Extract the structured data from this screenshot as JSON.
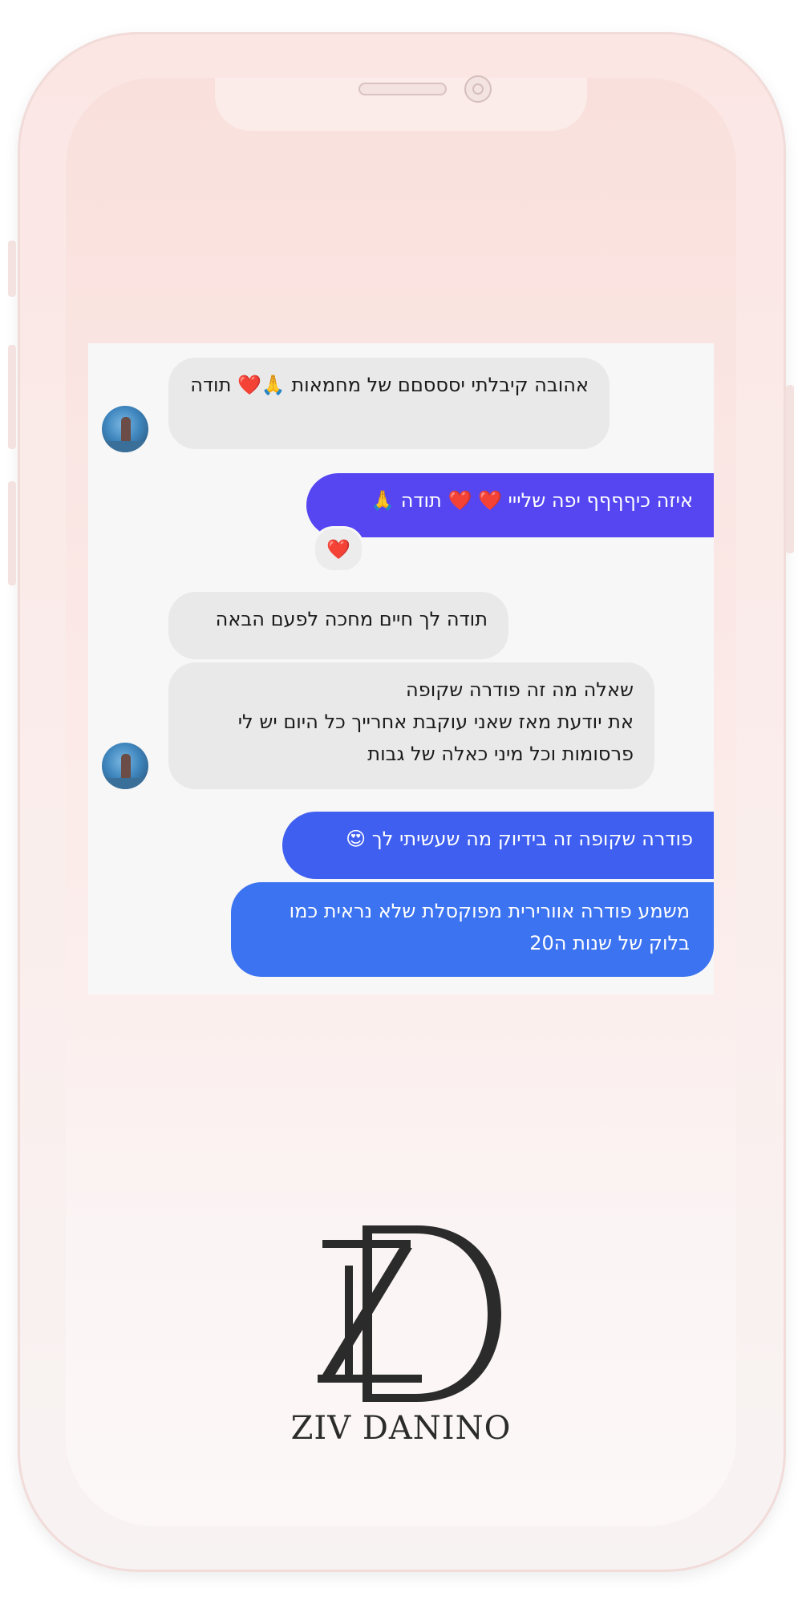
{
  "brand": {
    "name": "ZIV DANINO"
  },
  "chat": {
    "messages": [
      {
        "text": "אהובה קיבלתי יסססםם של מחמאות 🙏❤️ תודה",
        "direction": "incoming"
      },
      {
        "text": "איזה כיףףףף יפה שלייי ❤️ ❤️ תודה 🙏",
        "direction": "outgoing"
      },
      {
        "text": "תודה לך חיים מחכה לפעם הבאה",
        "direction": "incoming"
      },
      {
        "text": "שאלה מה זה פודרה שקופה\nאת יודעת מאז שאני עוקבת אחרייך כל היום יש לי פרסומות וכל מיני כאלה של גבות",
        "direction": "incoming"
      },
      {
        "text": "פודרה שקופה זה בידיוק מה שעשיתי לך 😍",
        "direction": "outgoing"
      },
      {
        "text": "משמע פודרה אוורירית מפוקסלת שלא נראית כמו בלוק של שנות ה20",
        "direction": "outgoing"
      }
    ],
    "reaction": "❤️"
  },
  "colors": {
    "incoming_bubble": "#e9e9e9",
    "outgoing_purple": "#5546f2",
    "outgoing_blue": "#3c73f0",
    "heart": "#e0182d"
  },
  "icons": [
    "avatar",
    "heart-icon",
    "praying-hands-icon",
    "heart-eyes-icon",
    "logo-zd"
  ]
}
